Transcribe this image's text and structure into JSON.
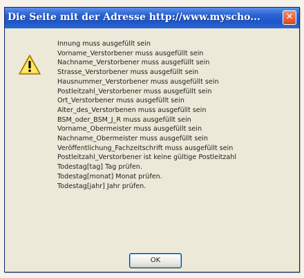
{
  "window": {
    "title": "Die Seite mit der Adresse http://www.myscho...",
    "close_icon": "close-icon"
  },
  "icon": "warning-icon",
  "messages": [
    "Innung muss ausgefüllt sein",
    "Vorname_Verstorbener muss ausgefüllt sein",
    "Nachname_Verstorbener muss ausgefüllt sein",
    "Strasse_Verstorbener muss ausgefüllt sein",
    "Hausnummer_Verstorbener muss ausgefüllt sein",
    "Postleitzahl_Verstorbener muss ausgefüllt sein",
    "Ort_Verstorbener muss ausgefüllt sein",
    "Alter_des_Verstorbenen muss ausgefüllt sein",
    "BSM_oder_BSM_J_R muss ausgefüllt sein",
    "Vorname_Obermeister muss ausgefüllt sein",
    "Nachname_Obermeister muss ausgefüllt sein",
    "Veröffentlichung_Fachzeitschrift muss ausgefüllt sein",
    "Postleitzahl_Verstorbener ist keine gültige Postleitzahl",
    "Todestag[tag] Tag prüfen.",
    "Todestag[monat] Monat prüfen.",
    "Todestag[jahr] Jahr prüfen."
  ],
  "buttons": {
    "ok_label": "OK"
  }
}
